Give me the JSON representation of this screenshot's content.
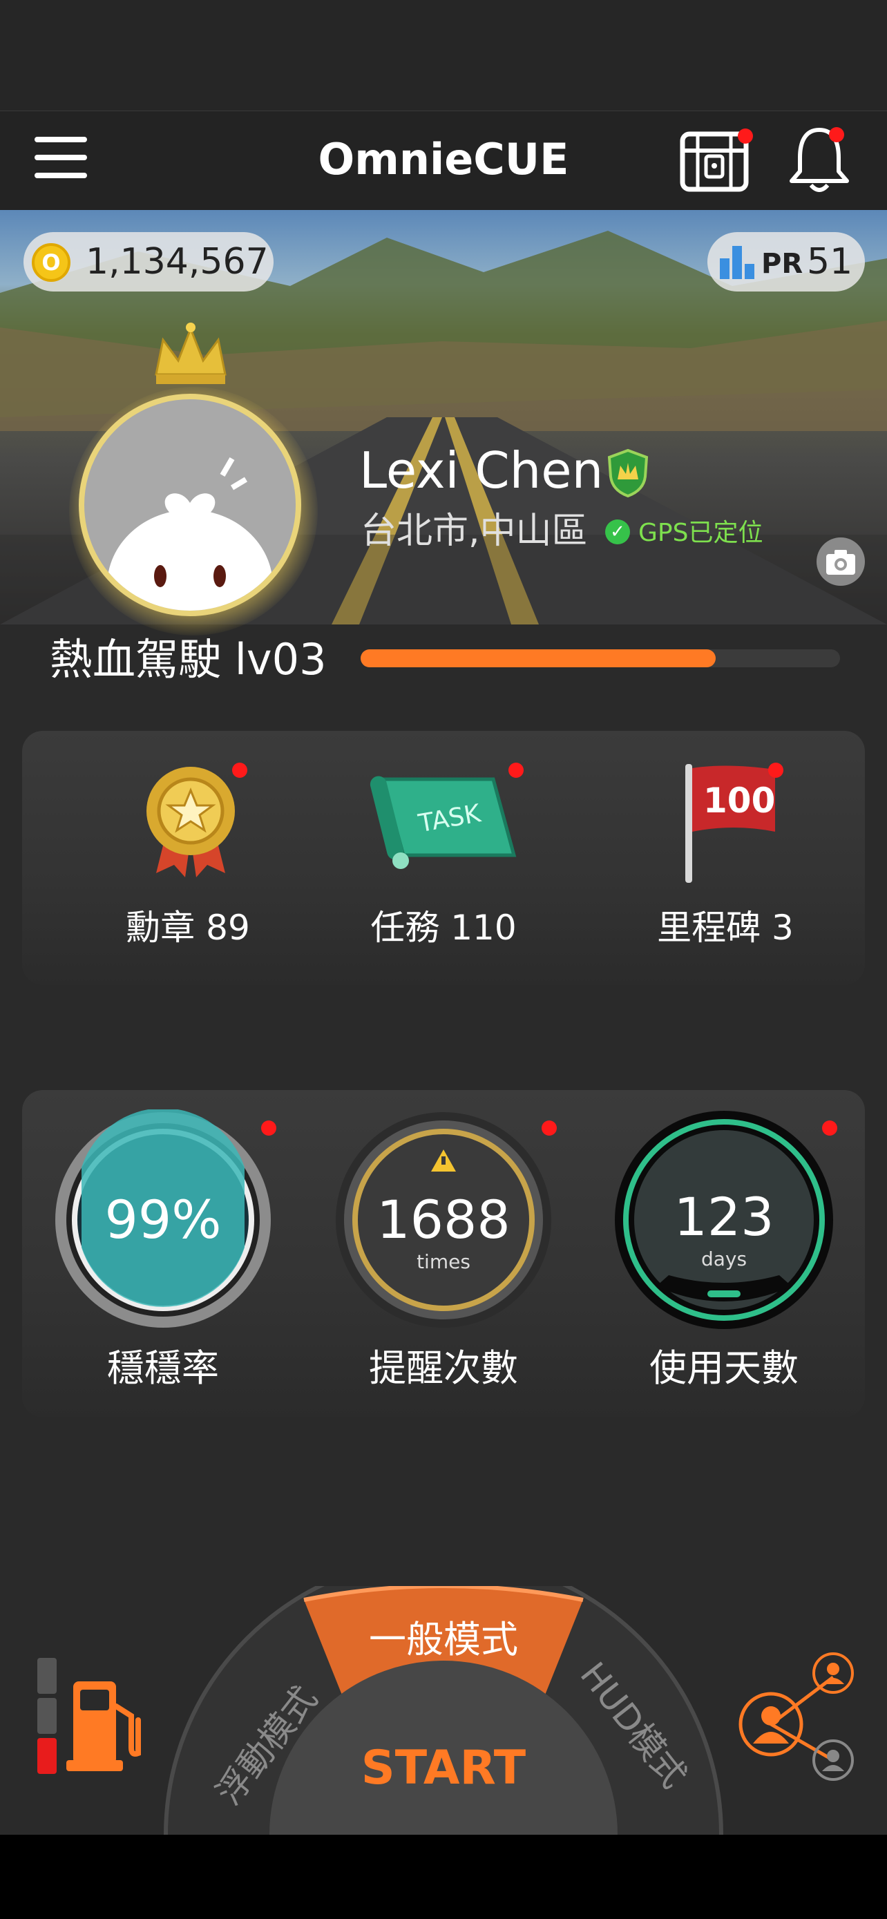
{
  "app": {
    "title": "OmnieCUE"
  },
  "wallet": {
    "coins": "1,134,567",
    "coin_symbol": "O"
  },
  "rank": {
    "label": "PR",
    "value": "51"
  },
  "user": {
    "name": "Lexi Chen",
    "location": "台北市,中山區",
    "gps_status": "GPS已定位"
  },
  "level": {
    "label": "熱血駕駛 lv03",
    "progress": 0.74
  },
  "achievements": [
    {
      "label": "勳章 89",
      "icon": "medal-icon"
    },
    {
      "label": "任務 110",
      "icon": "task-scroll-icon",
      "icon_text": "TASK"
    },
    {
      "label": "里程碑 3",
      "icon": "milestone-flag-icon",
      "icon_text": "100"
    }
  ],
  "stats": [
    {
      "value": "99%",
      "unit": "",
      "label": "穩穩率",
      "icon": "stability-gauge-icon"
    },
    {
      "value": "1688",
      "unit": "times",
      "label": "提醒次數",
      "icon": "warning-gauge-icon"
    },
    {
      "value": "123",
      "unit": "days",
      "label": "使用天數",
      "icon": "days-gauge-icon"
    }
  ],
  "modes": {
    "left": "浮動模式",
    "center": "一般模式",
    "right": "HUD模式",
    "start": "START"
  },
  "colors": {
    "accent": "#ff7a24",
    "notification": "#ff1a1a",
    "gps_ok": "#36c24a"
  }
}
